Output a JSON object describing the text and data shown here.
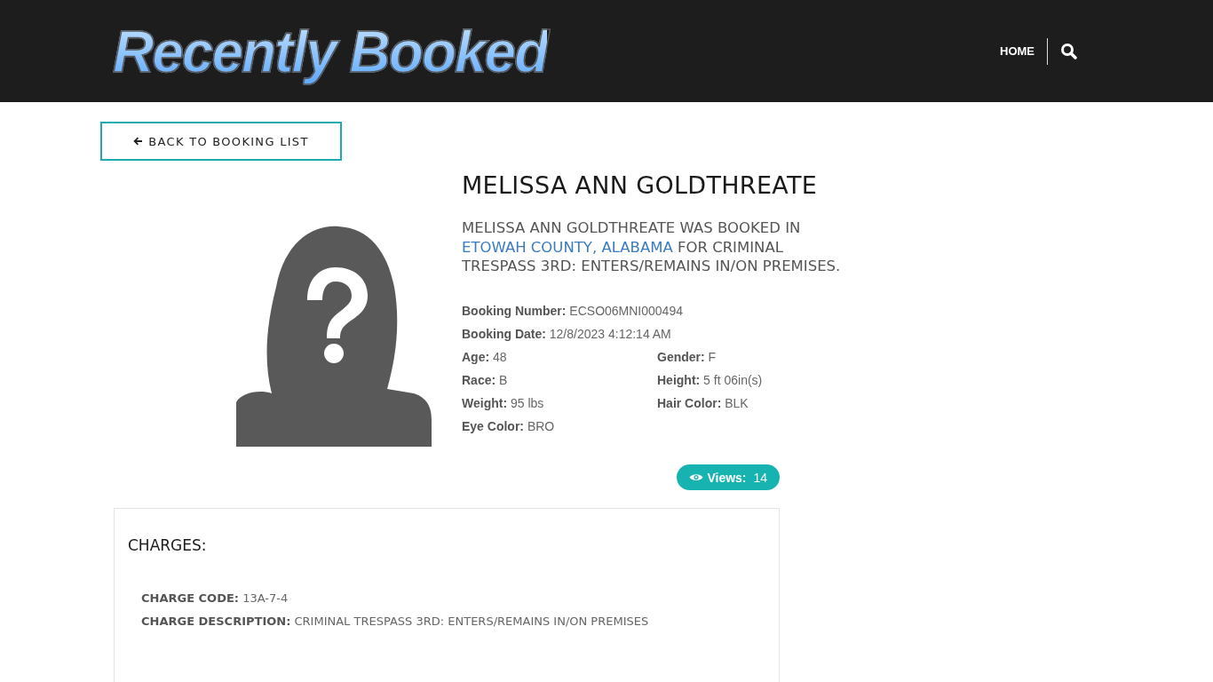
{
  "header": {
    "logo": "Recently Booked",
    "nav": [
      {
        "label": "HOME"
      }
    ]
  },
  "back_button": "BACK TO BOOKING LIST",
  "name": "MELISSA ANN GOLDTHREATE",
  "summary": {
    "before": "MELISSA ANN GOLDTHREATE WAS BOOKED IN",
    "link": "ETOWAH COUNTY, ALABAMA",
    "after": "FOR CRIMINAL TRESPASS 3RD: ENTERS/REMAINS IN/ON PREMISES."
  },
  "details": [
    [
      {
        "label": "Booking Number:",
        "value": "ECSO06MNI000494"
      }
    ],
    [
      {
        "label": "Booking Date:",
        "value": "12/8/2023 4:12:14 AM"
      }
    ],
    [
      {
        "label": "Age:",
        "value": "48"
      },
      {
        "label": "Gender:",
        "value": "F"
      }
    ],
    [
      {
        "label": "Race:",
        "value": "B"
      },
      {
        "label": "Height:",
        "value": "5 ft 06in(s)"
      }
    ],
    [
      {
        "label": "Weight:",
        "value": "95 lbs"
      },
      {
        "label": "Hair Color:",
        "value": "BLK"
      }
    ],
    [
      {
        "label": "Eye Color:",
        "value": "BRO"
      }
    ]
  ],
  "views": {
    "label": "Views:",
    "count": "14"
  },
  "charges": {
    "title": "CHARGES:",
    "items": [
      {
        "label": "CHARGE CODE:",
        "value": "13A-7-4"
      },
      {
        "label": "CHARGE DESCRIPTION:",
        "value": "CRIMINAL TRESPASS 3RD: ENTERS/REMAINS IN/ON PREMISES"
      }
    ]
  }
}
